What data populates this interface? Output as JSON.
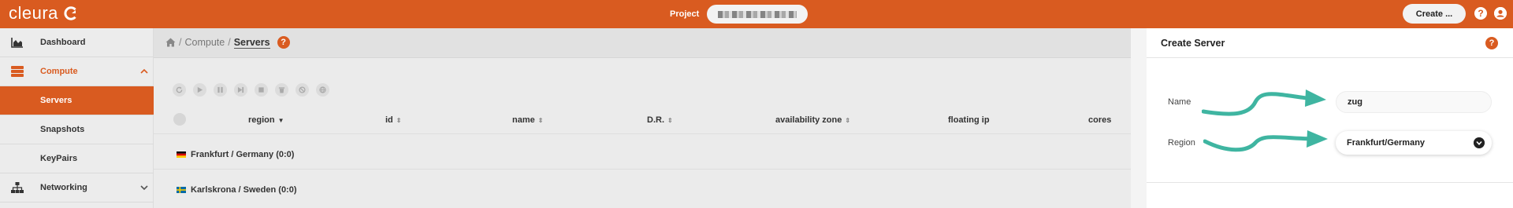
{
  "topbar": {
    "logo_text": "cleura",
    "project_label": "Project",
    "project_value_obscured": true,
    "create_label": "Create ...",
    "help_icon": "question-circle-icon",
    "user_icon": "user-circle-icon",
    "accent_color": "#d95b20"
  },
  "sidebar": {
    "items": [
      {
        "label": "Dashboard",
        "icon": "chart-area-icon",
        "state": "normal"
      },
      {
        "label": "Compute",
        "icon": "server-stack-icon",
        "state": "expanded"
      },
      {
        "label": "Servers",
        "state": "active"
      },
      {
        "label": "Snapshots",
        "state": "normal"
      },
      {
        "label": "KeyPairs",
        "state": "normal"
      },
      {
        "label": "Networking",
        "icon": "network-icon",
        "state": "collapsed"
      }
    ]
  },
  "breadcrumb": {
    "home_icon": "home-icon",
    "items": [
      "Compute",
      "Servers"
    ],
    "help_icon": "question-circle-icon"
  },
  "toolbar": {
    "icons": [
      "refresh-icon",
      "play-icon",
      "pause-icon",
      "step-forward-icon",
      "stop-icon",
      "trash-icon",
      "ban-icon",
      "globe-icon"
    ]
  },
  "table": {
    "columns": [
      {
        "label": "region",
        "sort": "desc"
      },
      {
        "label": "id",
        "sort": "both"
      },
      {
        "label": "name",
        "sort": "both"
      },
      {
        "label": "D.R.",
        "sort": "both"
      },
      {
        "label": "availability zone",
        "sort": "both"
      },
      {
        "label": "floating ip",
        "sort": "none"
      },
      {
        "label": "cores",
        "sort": "none"
      }
    ],
    "groups": [
      {
        "label": "Frankfurt / Germany",
        "count": "(0:0)",
        "flag": "de"
      },
      {
        "label": "Karlskrona / Sweden",
        "count": "(0:0)",
        "flag": "se"
      }
    ]
  },
  "panel": {
    "title": "Create Server",
    "help_icon": "question-circle-icon",
    "name_label": "Name",
    "name_value": "zug",
    "region_label": "Region",
    "region_value": "Frankfurt/Germany",
    "arrow_color": "#3fb5a1"
  }
}
